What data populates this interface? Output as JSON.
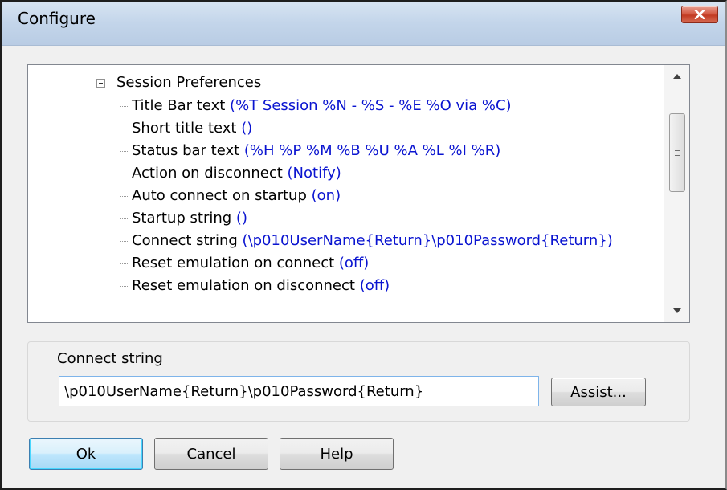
{
  "window": {
    "title": "Configure",
    "close_icon": "close-x-icon"
  },
  "tree": {
    "root_label": "Session Preferences",
    "items": [
      {
        "label": "Title Bar text ",
        "value": "(%T Session %N - %S - %E %O via %C)"
      },
      {
        "label": "Short title text ",
        "value": "()"
      },
      {
        "label": "Status bar text ",
        "value": "(%H %P %M %B %U %A %L %I %R)"
      },
      {
        "label": "Action on disconnect ",
        "value": "(Notify)"
      },
      {
        "label": "Auto connect on startup ",
        "value": "(on)"
      },
      {
        "label": "Startup string ",
        "value": "()"
      },
      {
        "label": "Connect string ",
        "value": "(\\p010UserName{Return}\\p010Password{Return})"
      },
      {
        "label": "Reset emulation on connect ",
        "value": "(off)"
      },
      {
        "label": "Reset emulation on disconnect ",
        "value": "(off)"
      }
    ]
  },
  "editor": {
    "label": "Connect string",
    "value": "\\p010UserName{Return}\\p010Password{Return}",
    "assist_label": "Assist..."
  },
  "buttons": {
    "ok": "Ok",
    "cancel": "Cancel",
    "help": "Help"
  },
  "colors": {
    "value_text": "#0a14d0",
    "close_button": "#c23a22",
    "input_border": "#7eb4ea"
  }
}
